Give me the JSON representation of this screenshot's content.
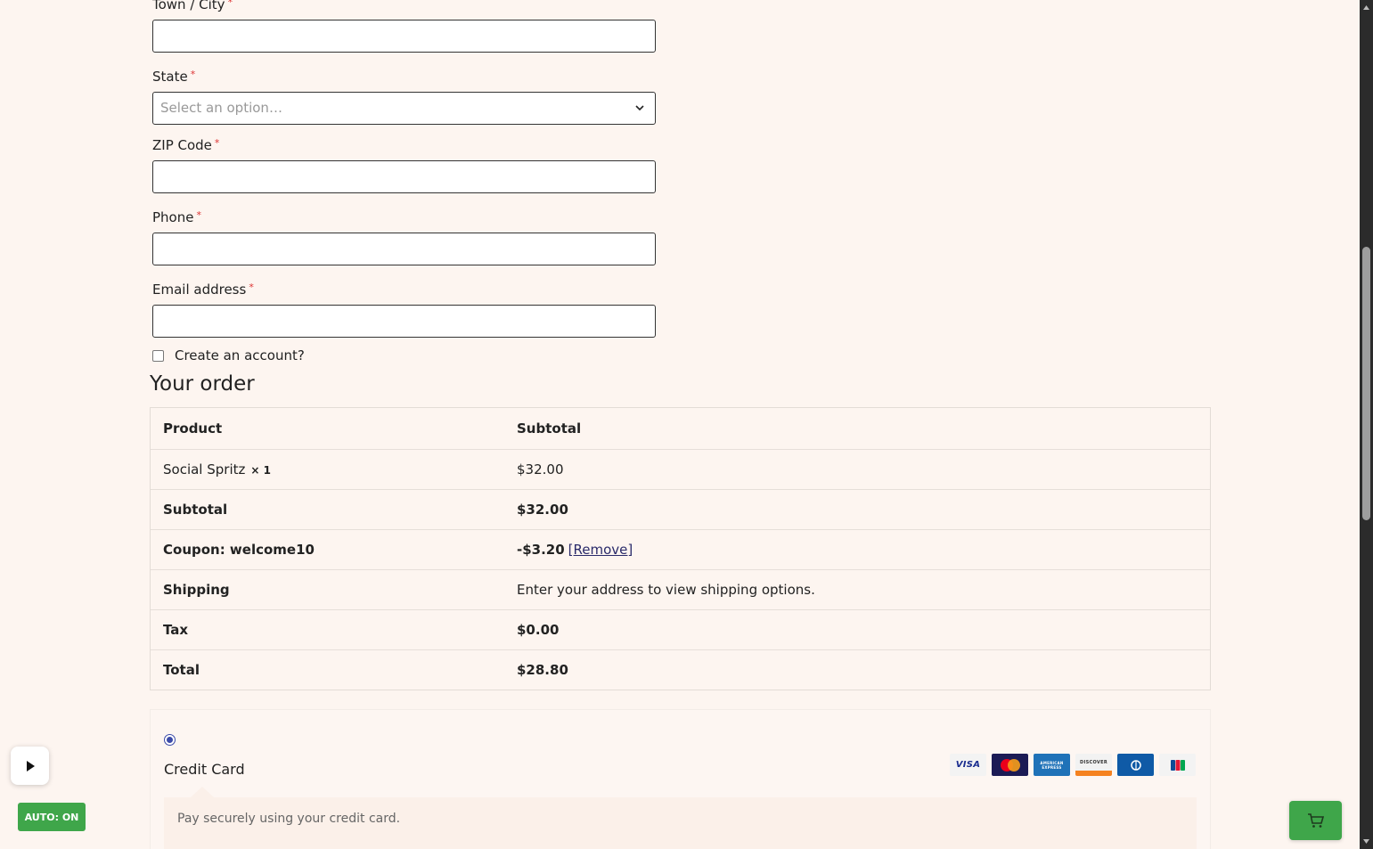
{
  "form": {
    "fields": [
      {
        "label": "Town / City",
        "required_mark": "*"
      },
      {
        "label": "State",
        "required_mark": "*",
        "placeholder": "Select an option…"
      },
      {
        "label": "ZIP Code",
        "required_mark": "*"
      },
      {
        "label": "Phone",
        "required_mark": "*"
      },
      {
        "label": "Email address",
        "required_mark": "*"
      }
    ],
    "create_account_label": "Create an account?"
  },
  "order": {
    "title": "Your order",
    "headers": {
      "product": "Product",
      "subtotal": "Subtotal"
    },
    "item": {
      "name": "Social Spritz",
      "qty": "× 1",
      "price": "$32.00"
    },
    "subtotal": {
      "label": "Subtotal",
      "value": "$32.00"
    },
    "coupon": {
      "label": "Coupon: welcome10",
      "value": "-$3.20",
      "remove": "[Remove]"
    },
    "shipping": {
      "label": "Shipping",
      "value": "Enter your address to view shipping options."
    },
    "tax": {
      "label": "Tax",
      "value": "$0.00"
    },
    "total": {
      "label": "Total",
      "value": "$28.80"
    }
  },
  "payment": {
    "method_label": "Credit Card",
    "description": "Pay securely using your credit card.",
    "cards": [
      "VISA",
      "MASTERCARD",
      "AMERICAN EXPRESS",
      "DISCOVER",
      "DINERS CLUB",
      "JCB"
    ],
    "card_text": {
      "visa": "VISA",
      "amex": "AMERICAN EXPRESS",
      "discover": "DISCOVER",
      "jcb": "JCB"
    }
  },
  "widgets": {
    "auto_badge": "AUTO: ON"
  },
  "colors": {
    "background": "#fdf5f0",
    "accent_green": "#3fa64a",
    "radio_blue": "#3b4aa8",
    "required_red": "#dd3333"
  }
}
